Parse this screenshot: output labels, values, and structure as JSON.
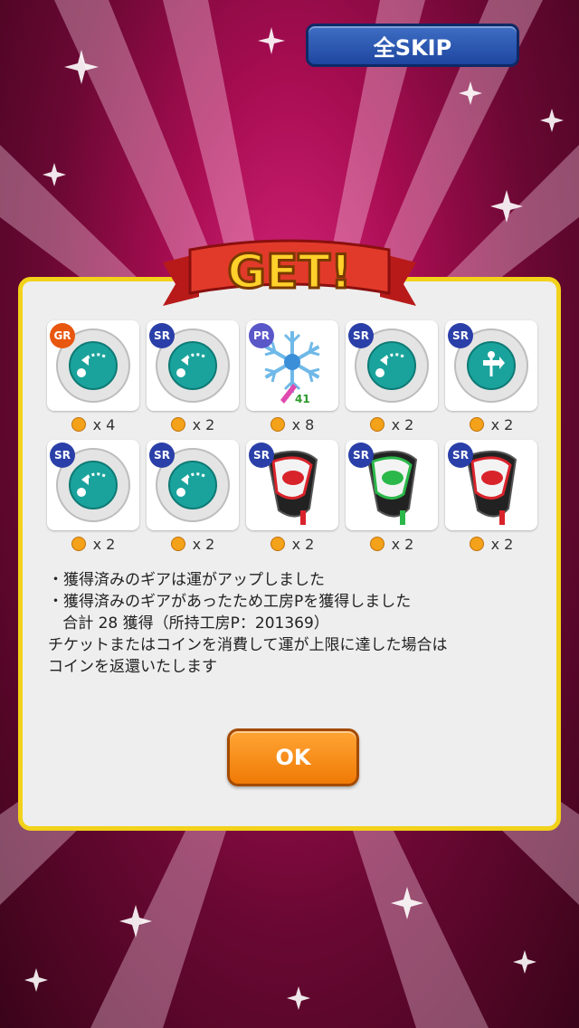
{
  "header": {
    "skip_label": "全SKIP"
  },
  "banner": {
    "title": "GET!"
  },
  "items": [
    {
      "rarity": "GR",
      "icon": "golf-ball-curve-icon",
      "count": "x 4",
      "color": "#e8570f"
    },
    {
      "rarity": "SR",
      "icon": "golf-ball-curve-icon",
      "count": "x 2",
      "color": "#2a3fa8"
    },
    {
      "rarity": "PR",
      "icon": "snowflake-icon",
      "count": "x 8",
      "badge": "41",
      "color": "#5a57c9"
    },
    {
      "rarity": "SR",
      "icon": "golf-ball-curve-icon",
      "count": "x 2",
      "color": "#2a3fa8"
    },
    {
      "rarity": "SR",
      "icon": "golf-ball-weathervane-icon",
      "count": "x 2",
      "color": "#2a3fa8"
    },
    {
      "rarity": "SR",
      "icon": "golf-ball-curve-icon",
      "count": "x 2",
      "color": "#2a3fa8"
    },
    {
      "rarity": "SR",
      "icon": "golf-ball-curve-icon",
      "count": "x 2",
      "color": "#2a3fa8"
    },
    {
      "rarity": "SR",
      "icon": "driver-club-red-icon",
      "count": "x 2",
      "color": "#2a3fa8"
    },
    {
      "rarity": "SR",
      "icon": "driver-club-green-icon",
      "count": "x 2",
      "color": "#2a3fa8"
    },
    {
      "rarity": "SR",
      "icon": "driver-club-red-icon",
      "count": "x 2",
      "color": "#2a3fa8"
    }
  ],
  "message": {
    "line1": "・獲得済みのギアは運がアップしました",
    "line2": "・獲得済みのギアがあったため工房Pを獲得しました",
    "line3": "   合計 28 獲得（所持工房P：201369）",
    "line4": "チケットまたはコインを消費して運が上限に達した場合は",
    "line5": "コインを返還いたします"
  },
  "ok_label": "OK",
  "colors": {
    "panel_border": "#f2d21a",
    "ok": "#f07a05",
    "skip": "#2a57b5",
    "background": "#b0105a"
  }
}
